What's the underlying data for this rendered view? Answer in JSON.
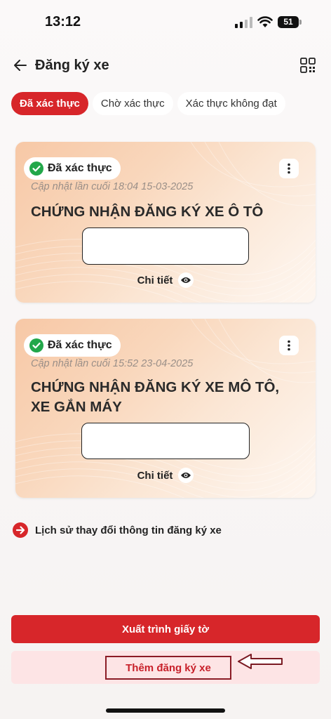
{
  "status_bar": {
    "time": "13:12",
    "battery": "51"
  },
  "header": {
    "title": "Đăng ký xe"
  },
  "tabs": [
    {
      "label": "Đã xác thực",
      "active": true
    },
    {
      "label": "Chờ xác thực",
      "active": false
    },
    {
      "label": "Xác thực không đạt",
      "active": false
    }
  ],
  "cards": [
    {
      "status": "Đã xác thực",
      "updated": "Cập nhật lần cuối 18:04 15-03-2025",
      "title_lines": [
        "CHỨNG NHẬN ĐĂNG KÝ XE Ô TÔ"
      ],
      "detail_label": "Chi tiết"
    },
    {
      "status": "Đã xác thực",
      "updated": "Cập nhật lần cuối 15:52 23-04-2025",
      "title_lines": [
        "CHỨNG NHẬN ĐĂNG KÝ XE MÔ TÔ,",
        "XE GẮN MÁY"
      ],
      "detail_label": "Chi tiết"
    }
  ],
  "history_link": {
    "label": "Lịch sử thay đổi thông tin đăng ký xe"
  },
  "actions": {
    "primary_label": "Xuất trình giấy tờ",
    "secondary_label": "Thêm đăng ký xe"
  },
  "colors": {
    "brand_red": "#d7262a",
    "verified_green": "#22a74a",
    "secondary_bg": "#fde4e5"
  },
  "icons": [
    "back-arrow-icon",
    "qr-code-icon",
    "check-circle-icon",
    "more-vertical-icon",
    "eye-icon",
    "arrow-right-circle-icon",
    "annotation-arrow-icon"
  ]
}
